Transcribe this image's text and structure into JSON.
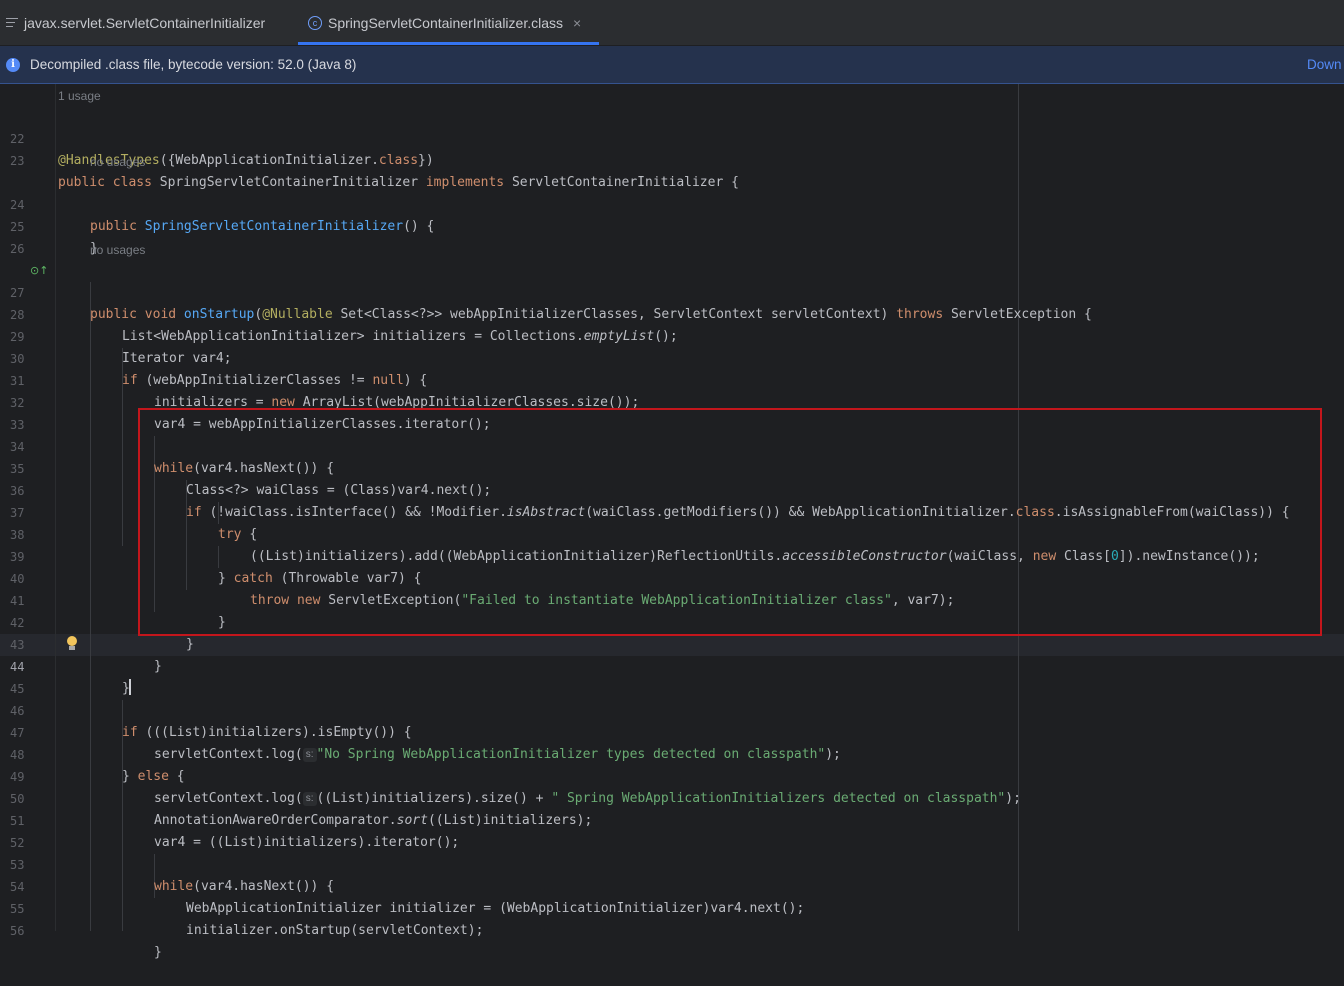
{
  "tabs": [
    {
      "label": "javax.servlet.ServletContainerInitializer",
      "icon": "file-lines-icon"
    },
    {
      "label": "SpringServletContainerInitializer.class",
      "icon": "class-icon",
      "close": "×"
    }
  ],
  "banner": {
    "message": "Decompiled .class file, bytecode version: 52.0 (Java 8)",
    "action": "Down"
  },
  "hints": {
    "usage_1": "1 usage",
    "no_usages_1": "no usages",
    "no_usages_2": "no usages",
    "param_s": "s:",
    "param_s2": "s:"
  },
  "line_numbers": [
    "22",
    "23",
    "24",
    "25",
    "26",
    "27",
    "28",
    "29",
    "30",
    "31",
    "32",
    "33",
    "34",
    "35",
    "36",
    "37",
    "38",
    "39",
    "40",
    "41",
    "42",
    "43",
    "44",
    "45",
    "46",
    "47",
    "48",
    "49",
    "50",
    "51",
    "52",
    "53",
    "54",
    "55",
    "56"
  ],
  "code": {
    "l22": [
      "@HandlesTypes",
      "({WebApplicationInitializer.",
      "class",
      "})"
    ],
    "l23": [
      "public class ",
      "SpringServletContainerInitializer ",
      "implements ",
      "ServletContainerInitializer {"
    ],
    "l24": [
      "public ",
      "SpringServletContainerInitializer",
      "() {"
    ],
    "l25": "}",
    "l27": [
      "public void ",
      "onStartup",
      "(",
      "@Nullable ",
      "Set<Class<?>> webAppInitializerClasses, ServletContext servletContext) ",
      "throws ",
      "ServletException {"
    ],
    "l28": [
      "List<WebApplicationInitializer> initializers = Collections.",
      "emptyList",
      "();"
    ],
    "l29": "Iterator var4;",
    "l30": [
      "if ",
      "(webAppInitializerClasses != ",
      "null",
      ") {"
    ],
    "l31": [
      "initializers = ",
      "new ",
      "ArrayList(webAppInitializerClasses.size());"
    ],
    "l32": "var4 = webAppInitializerClasses.iterator();",
    "l34": [
      "while",
      "(var4.hasNext()) {"
    ],
    "l35": "Class<?> waiClass = (Class)var4.next();",
    "l36": [
      "if ",
      "(!waiClass.isInterface() && !Modifier.",
      "isAbstract",
      "(waiClass.getModifiers()) && WebApplicationInitializer.",
      "class",
      ".isAssignableFrom(waiClass)) {"
    ],
    "l37": [
      "try ",
      "{"
    ],
    "l38": [
      "((List)initializers).add((WebApplicationInitializer)ReflectionUtils.",
      "accessibleConstructor",
      "(waiClass, ",
      "new ",
      "Class[",
      "0",
      "]).newInstance());"
    ],
    "l39": [
      "} ",
      "catch ",
      "(Throwable var7) {"
    ],
    "l40": [
      "throw new ",
      "ServletException(",
      "\"Failed to instantiate WebApplicationInitializer class\"",
      ", var7);"
    ],
    "l41": "}",
    "l42": "}",
    "l43": "}",
    "l44": "}",
    "l46": [
      "if ",
      "(((List)initializers).isEmpty()) {"
    ],
    "l47": [
      "servletContext.log(",
      "\"No Spring WebApplicationInitializer types detected on classpath\"",
      ");"
    ],
    "l48": [
      "} ",
      "else ",
      "{"
    ],
    "l49": [
      "servletContext.log(",
      "((List)initializers).size() + ",
      "\" Spring WebApplicationInitializers detected on classpath\"",
      ");"
    ],
    "l50": [
      "AnnotationAwareOrderComparator.",
      "sort",
      "((List)initializers);"
    ],
    "l51": "var4 = ((List)initializers).iterator();",
    "l53": [
      "while",
      "(var4.hasNext()) {"
    ],
    "l54": "WebApplicationInitializer initializer = (WebApplicationInitializer)var4.next();",
    "l55": "initializer.onStartup(servletContext);",
    "l56": "}"
  },
  "colors": {
    "background": "#1e1f22",
    "keyword": "#cf8e6d",
    "annotation": "#b3ae60",
    "method": "#56a8f5",
    "string": "#6aab73",
    "highlight_box": "#c3161c",
    "accent": "#3574f0"
  }
}
